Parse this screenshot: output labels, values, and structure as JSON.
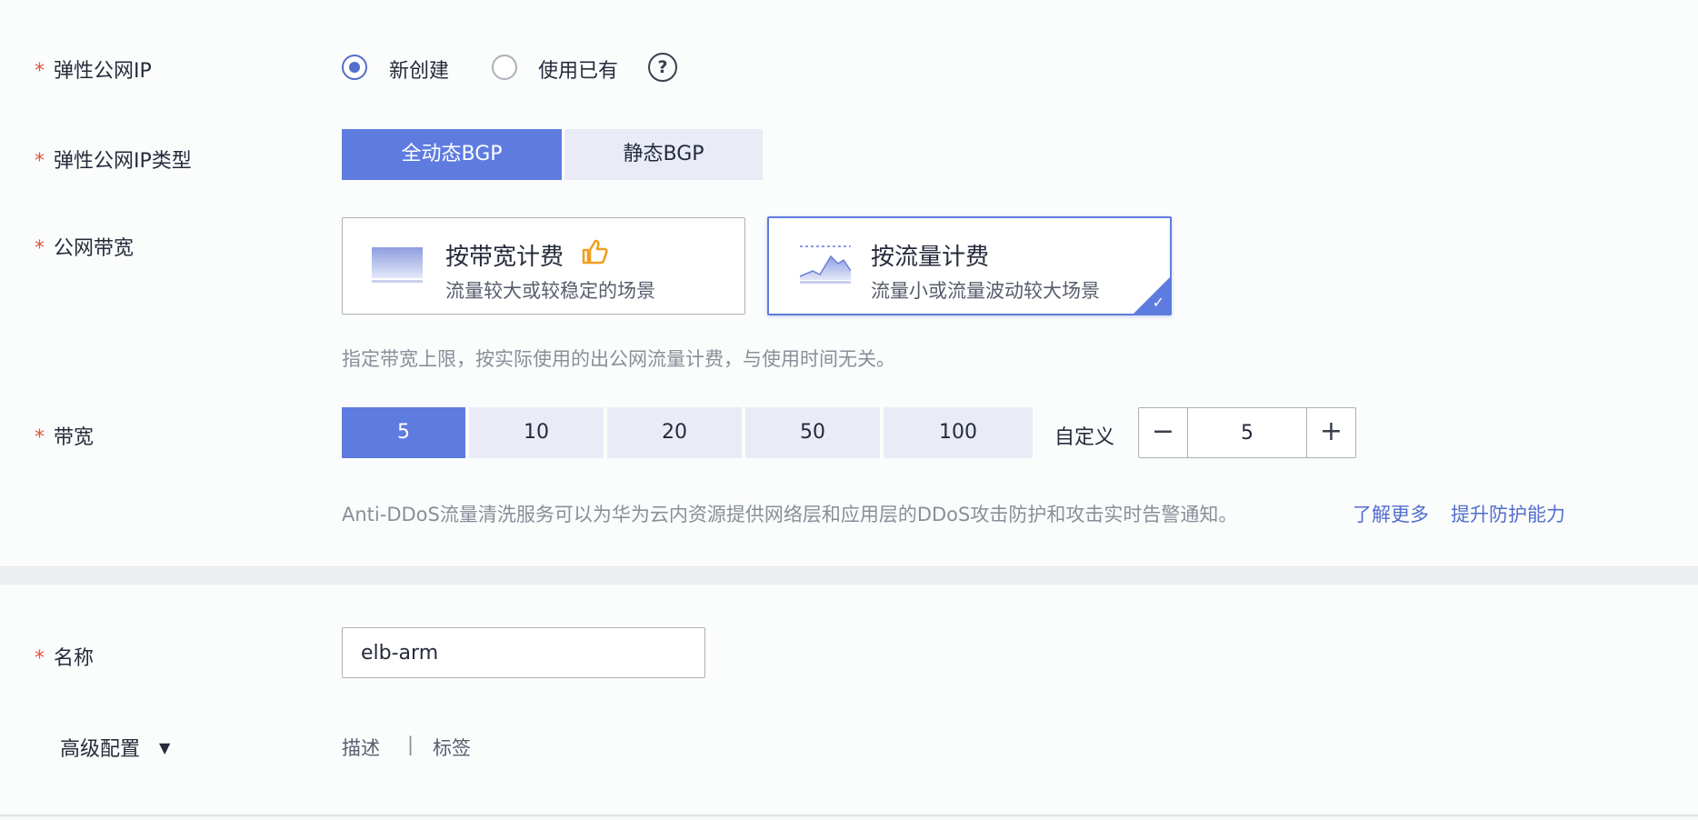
{
  "eip": {
    "label": "弹性公网IP",
    "options": [
      "新创建",
      "使用已有"
    ],
    "selected": "新创建",
    "help_icon": "question-circle-icon"
  },
  "eip_type": {
    "label": "弹性公网IP类型",
    "options": [
      "全动态BGP",
      "静态BGP"
    ],
    "selected": "全动态BGP"
  },
  "bandwidth_mode": {
    "label": "公网带宽",
    "cards": [
      {
        "title": "按带宽计费",
        "desc": "流量较大或较稳定的场景",
        "icon": "thumbs-up-icon"
      },
      {
        "title": "按流量计费",
        "desc": "流量小或流量波动较大场景"
      }
    ],
    "selected": "按流量计费",
    "hint": "指定带宽上限，按实际使用的出公网流量计费，与使用时间无关。"
  },
  "bandwidth": {
    "label": "带宽",
    "options": [
      "5",
      "10",
      "20",
      "50",
      "100"
    ],
    "selected": "5",
    "custom_label": "自定义",
    "custom_value": "5",
    "minus": "−",
    "plus": "+"
  },
  "anti_ddos": {
    "text": "Anti-DDoS流量清洗服务可以为华为云内资源提供网络层和应用层的DDoS攻击防护和攻击实时告警通知。",
    "learn_more": "了解更多",
    "upgrade": "提升防护能力"
  },
  "name": {
    "label": "名称",
    "value": "elb-arm"
  },
  "advanced": {
    "label": "高级配置",
    "arrow": "▼",
    "tabs": [
      "描述",
      "标签"
    ],
    "divider": "|"
  },
  "required_mark": "*",
  "colors": {
    "primary": "#5e7ce0",
    "required": "#e5553c",
    "link": "#526ecc"
  }
}
